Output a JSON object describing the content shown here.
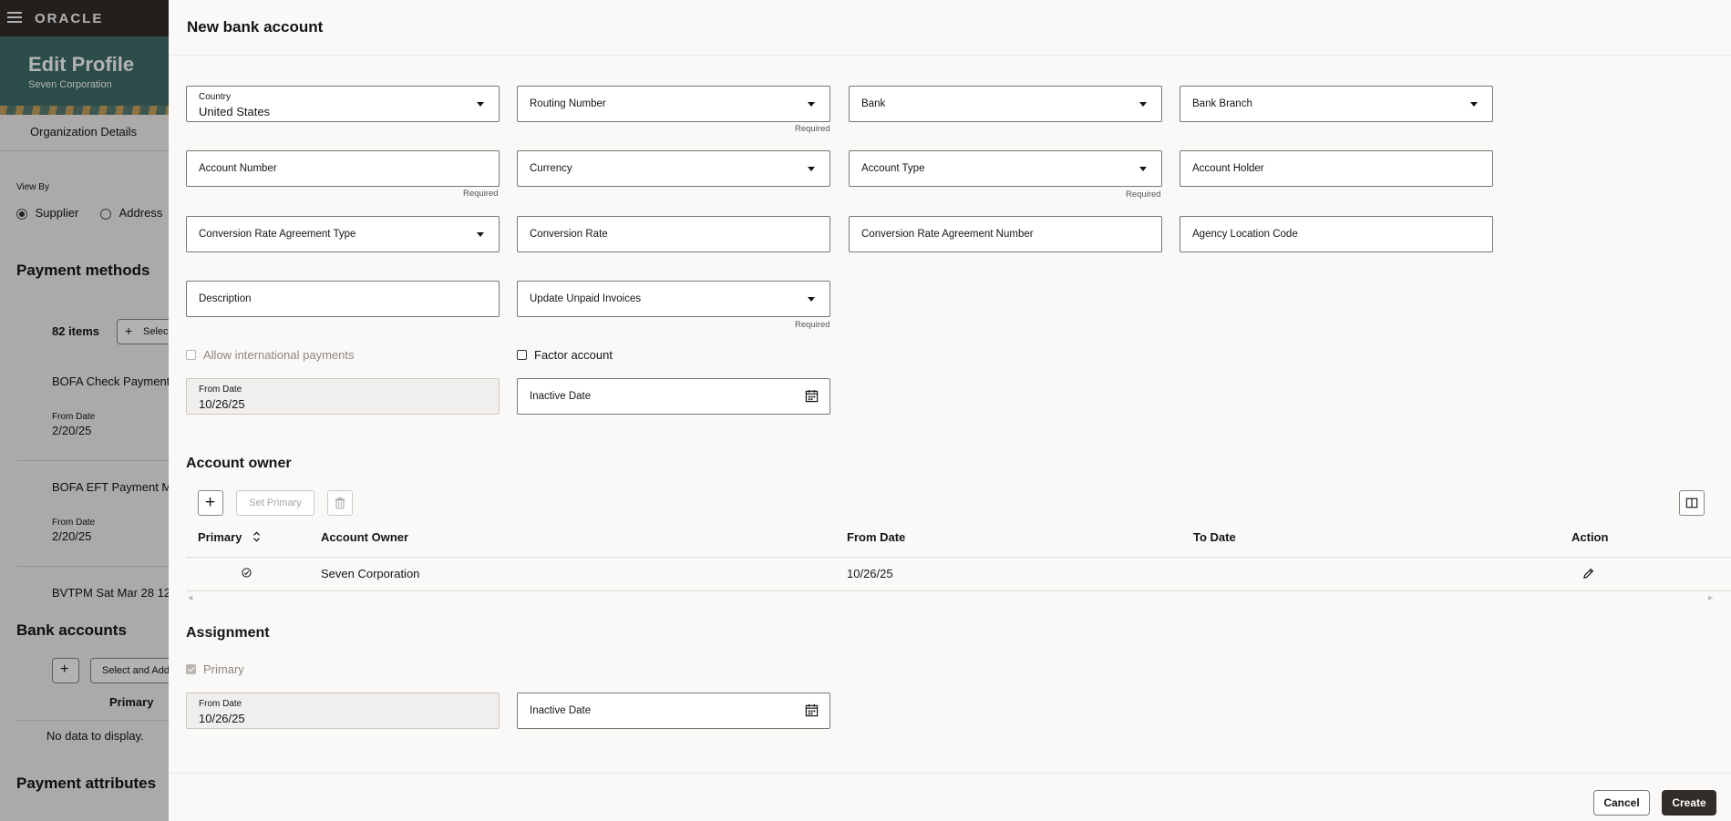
{
  "app": {
    "logo": "ORACLE"
  },
  "background": {
    "title": "Edit Profile",
    "subtitle": "Seven Corporation",
    "tab": "Organization Details",
    "view_by_label": "View By",
    "radio_supplier": "Supplier",
    "radio_address": "Address",
    "payment_methods_heading": "Payment methods",
    "items_count": "82 items",
    "select_button": "Selec",
    "pm_items": [
      {
        "name": "BOFA Check Payment",
        "from_label": "From Date",
        "from": "2/20/25"
      },
      {
        "name": "BOFA EFT Payment M",
        "from_label": "From Date",
        "from": "2/20/25"
      },
      {
        "name": "BVTPM Sat Mar 28 12"
      }
    ],
    "bank_accounts_heading": "Bank accounts",
    "select_and_add": "Select and Add",
    "primary_col": "Primary",
    "no_data": "No data to display.",
    "payment_attributes_heading": "Payment attributes"
  },
  "drawer": {
    "title": "New bank account",
    "fields": {
      "country": {
        "label": "Country",
        "value": "United States"
      },
      "routing_number": {
        "label": "Routing Number",
        "required": "Required"
      },
      "bank": {
        "label": "Bank"
      },
      "bank_branch": {
        "label": "Bank Branch"
      },
      "account_number": {
        "label": "Account Number",
        "required": "Required"
      },
      "currency": {
        "label": "Currency"
      },
      "account_type": {
        "label": "Account Type",
        "required": "Required"
      },
      "account_holder": {
        "label": "Account Holder"
      },
      "conv_rate_agreement_type": {
        "label": "Conversion Rate Agreement Type"
      },
      "conversion_rate": {
        "label": "Conversion Rate"
      },
      "conv_rate_agreement_number": {
        "label": "Conversion Rate Agreement Number"
      },
      "agency_location_code": {
        "label": "Agency Location Code"
      },
      "description": {
        "label": "Description"
      },
      "update_unpaid_invoices": {
        "label": "Update Unpaid Invoices",
        "required": "Required"
      },
      "from_date": {
        "label": "From Date",
        "value": "10/26/25"
      },
      "inactive_date": {
        "label": "Inactive Date"
      }
    },
    "allow_international": "Allow international payments",
    "factor_account": "Factor account",
    "account_owner": {
      "heading": "Account owner",
      "set_primary": "Set Primary",
      "columns": {
        "primary": "Primary",
        "owner": "Account Owner",
        "from": "From Date",
        "to": "To Date",
        "action": "Action"
      },
      "rows": [
        {
          "owner": "Seven Corporation",
          "from": "10/26/25",
          "to": ""
        }
      ]
    },
    "assignment": {
      "heading": "Assignment",
      "primary": "Primary",
      "from_date": {
        "label": "From Date",
        "value": "10/26/25"
      },
      "inactive_date": {
        "label": "Inactive Date"
      }
    },
    "footer": {
      "cancel": "Cancel",
      "create": "Create"
    }
  }
}
